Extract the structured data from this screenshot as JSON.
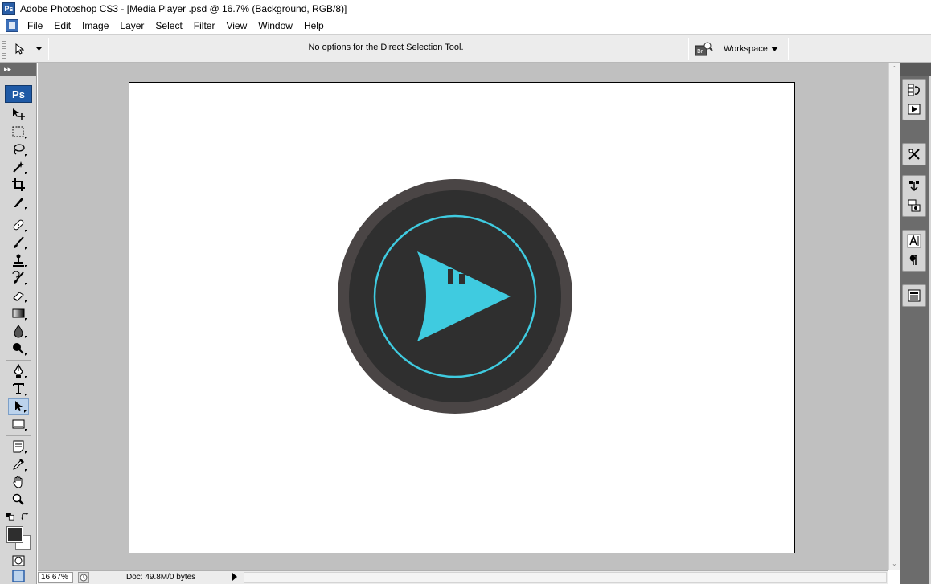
{
  "window": {
    "title": "Adobe Photoshop CS3 - [Media Player .psd @ 16.7% (Background, RGB/8)]",
    "app_icon": "Ps"
  },
  "menu": [
    "File",
    "Edit",
    "Image",
    "Layer",
    "Select",
    "Filter",
    "View",
    "Window",
    "Help"
  ],
  "options_bar": {
    "message": "No options for the Direct Selection Tool.",
    "bridge_label": "Br",
    "workspace_label": "Workspace"
  },
  "toolbox": {
    "logo": "Ps",
    "tools": [
      "move-tool",
      "marquee-tool",
      "lasso-tool",
      "magic-wand-tool",
      "crop-tool",
      "slice-tool",
      "healing-brush-tool",
      "brush-tool",
      "clone-stamp-tool",
      "history-brush-tool",
      "eraser-tool",
      "gradient-tool",
      "blur-tool",
      "dodge-tool",
      "pen-tool",
      "type-tool",
      "direct-selection-tool",
      "shape-tool",
      "notes-tool",
      "eyedropper-tool",
      "hand-tool",
      "zoom-tool"
    ],
    "active_tool": "direct-selection-tool",
    "foreground_color": "#2e2e2e",
    "background_color": "#ffffff"
  },
  "canvas": {
    "background": "#ffffff",
    "button_outer_ring": "#4a4545",
    "button_inner": "#2f2f2f",
    "accent": "#3fcbe0"
  },
  "status": {
    "zoom": "16.67%",
    "doc_info": "Doc: 49.8M/0 bytes"
  }
}
